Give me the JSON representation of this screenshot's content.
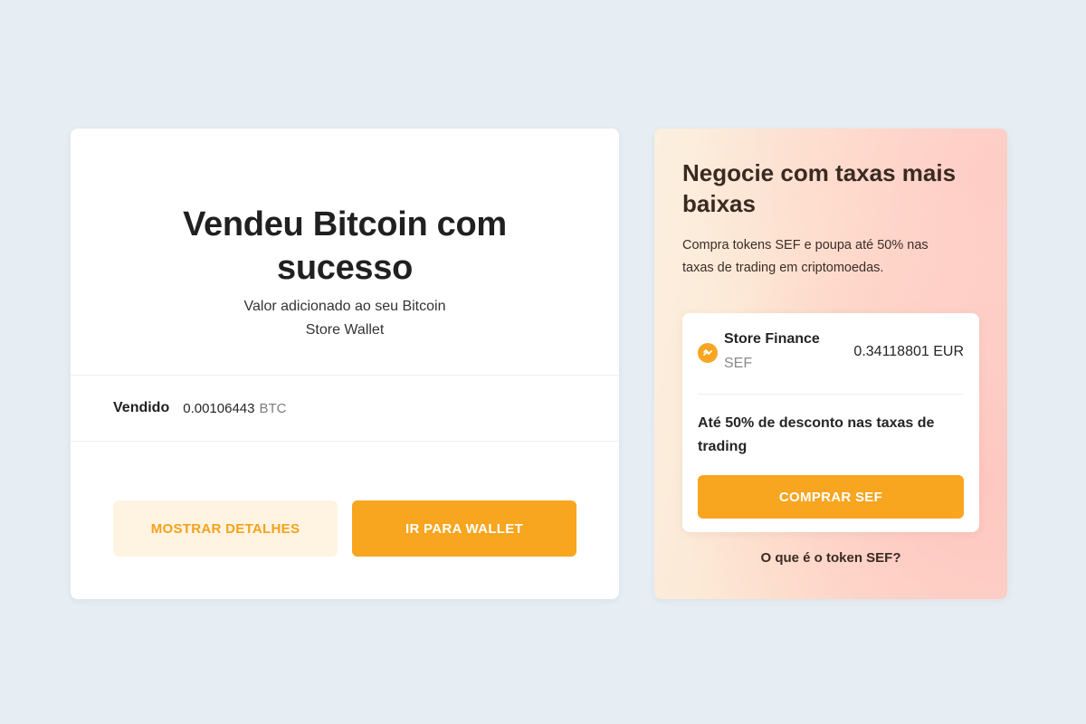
{
  "success": {
    "title_line1": "Vendeu Bitcoin com",
    "title_line2": "sucesso",
    "subtitle_line1": "Valor adicionado ao seu Bitcoin",
    "subtitle_line2": "Store Wallet",
    "sold_label": "Vendido",
    "sold_amount": "0.00106443",
    "sold_unit": "BTC",
    "details_button": "MOSTRAR DETALHES",
    "wallet_button": "IR PARA WALLET"
  },
  "promo": {
    "title_line1": "Negocie com taxas mais",
    "title_line2": "baixas",
    "desc_line1": "Compra tokens SEF e poupa até 50% nas",
    "desc_line2": "taxas de trading em criptomoedas.",
    "token": {
      "icon": "store-finance-logo-icon",
      "name": "Store Finance",
      "symbol": "SEF",
      "price": "0.34118801 EUR",
      "offer_line1": "Até 50% de desconto nas taxas de",
      "offer_line2": "trading",
      "buy_button": "COMPRAR SEF"
    },
    "info_link": "O que é o token SEF?"
  },
  "colors": {
    "page_background": "#e6edf3",
    "accent": "#f8a51f",
    "accent_soft": "#fff3e1"
  }
}
